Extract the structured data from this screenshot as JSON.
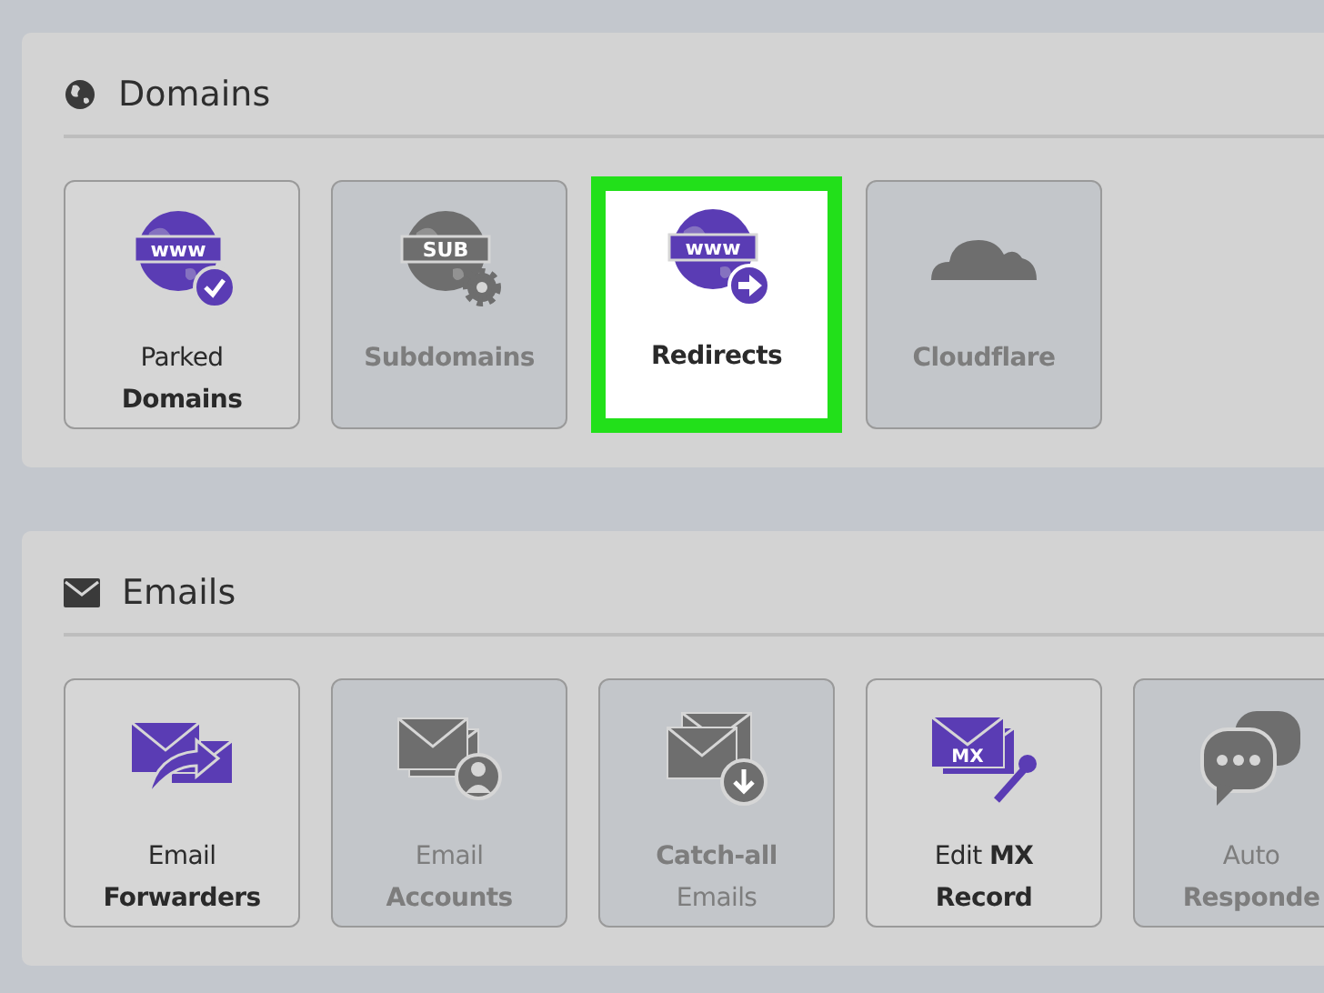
{
  "sections": [
    {
      "title": "Domains",
      "tiles": [
        {
          "kind": "parked",
          "badge": "www",
          "lines": [
            {
              "text": "Parked",
              "bold": false
            },
            {
              "text": "Domains",
              "bold": true
            }
          ],
          "disabled": false,
          "selected": false
        },
        {
          "kind": "subdomain",
          "badge": "SUB",
          "lines": [
            {
              "text": "Subdomains",
              "bold": true
            }
          ],
          "disabled": true,
          "selected": false
        },
        {
          "kind": "redirect",
          "badge": "www",
          "lines": [
            {
              "text": "Redirects",
              "bold": true
            }
          ],
          "disabled": false,
          "selected": true
        },
        {
          "kind": "cloud",
          "lines": [
            {
              "text": "Cloudflare",
              "bold": true
            }
          ],
          "disabled": true,
          "selected": false
        }
      ]
    },
    {
      "title": "Emails",
      "tiles": [
        {
          "kind": "forward",
          "lines": [
            {
              "text": "Email",
              "bold": false
            },
            {
              "text": "Forwarders",
              "bold": true
            }
          ],
          "disabled": false,
          "selected": false
        },
        {
          "kind": "account",
          "lines": [
            {
              "text": "Email",
              "bold": false
            },
            {
              "text": "Accounts",
              "bold": true
            }
          ],
          "disabled": true,
          "selected": false
        },
        {
          "kind": "catchall",
          "lines": [
            {
              "text": "Catch-all",
              "bold": true
            },
            {
              "text": "Emails",
              "bold": false
            }
          ],
          "disabled": true,
          "selected": false
        },
        {
          "kind": "mx",
          "badge": "MX",
          "lines": [
            {
              "text": "Edit **MX**",
              "bold": false
            },
            {
              "text": "Record",
              "bold": true
            }
          ],
          "disabled": false,
          "selected": false
        },
        {
          "kind": "chat",
          "lines": [
            {
              "text": "Auto",
              "bold": false
            },
            {
              "text": "Responde",
              "bold": true
            }
          ],
          "disabled": true,
          "selected": false
        }
      ]
    }
  ]
}
